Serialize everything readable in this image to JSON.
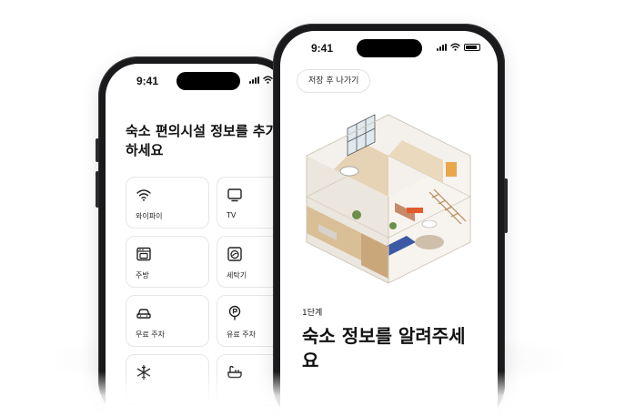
{
  "status_bar": {
    "time": "9:41"
  },
  "back_screen": {
    "title": "숙소 편의시설 정보를 추가하세요",
    "amenities": [
      {
        "label": "와이파이",
        "icon": "wifi-icon"
      },
      {
        "label": "TV",
        "icon": "tv-icon"
      },
      {
        "label": "주방",
        "icon": "kitchen-icon"
      },
      {
        "label": "세탁기",
        "icon": "washer-icon"
      },
      {
        "label": "무료 주차",
        "icon": "car-icon"
      },
      {
        "label": "유료 주차",
        "icon": "paid-parking-icon"
      },
      {
        "label": "",
        "icon": "snowflake-icon"
      },
      {
        "label": "",
        "icon": "bathtub-icon"
      }
    ]
  },
  "front_screen": {
    "save_exit_label": "저장 후 나가기",
    "step_label": "1단계",
    "title": "숙소 정보를 알려주세요",
    "illustration": "isometric-house-illustration"
  },
  "colors": {
    "phone_frame": "#1a1a1c",
    "card_border": "#e6e6e8",
    "text": "#111111"
  }
}
